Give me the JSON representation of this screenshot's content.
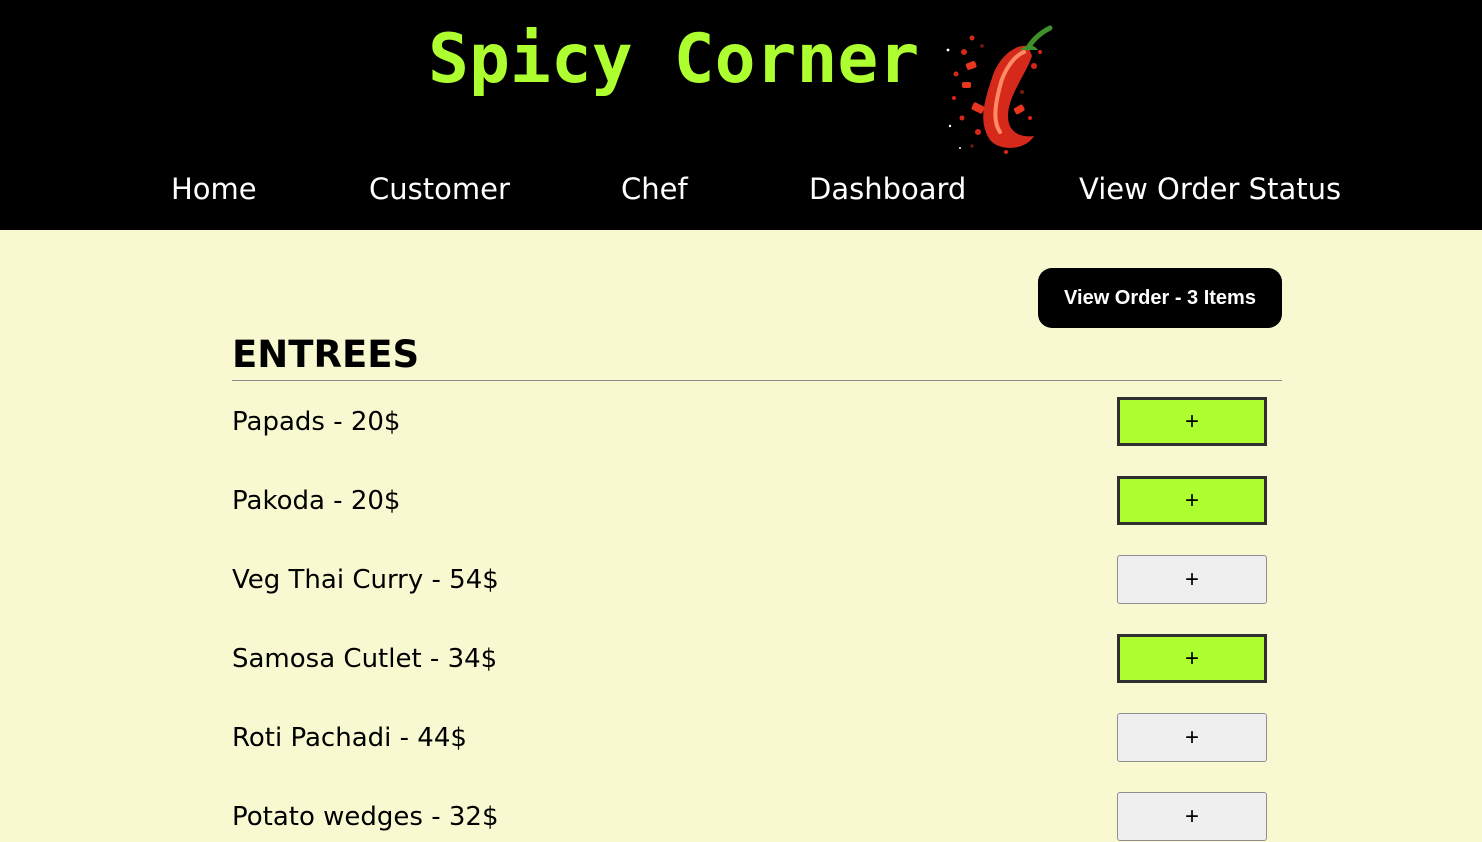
{
  "brand": {
    "title": "Spicy Corner",
    "logo_icon": "chili-pepper-icon"
  },
  "nav": {
    "home": "Home",
    "customer": "Customer",
    "chef": "Chef",
    "dashboard": "Dashboard",
    "order_status": "View Order Status"
  },
  "order": {
    "button_label": "View Order - 3 Items"
  },
  "menu": {
    "section_title": "ENTREES",
    "add_label": "+",
    "items": [
      {
        "label": "Papads - 20$",
        "selected": true
      },
      {
        "label": "Pakoda - 20$",
        "selected": true
      },
      {
        "label": "Veg Thai Curry - 54$",
        "selected": false
      },
      {
        "label": "Samosa Cutlet - 34$",
        "selected": true
      },
      {
        "label": "Roti Pachadi - 44$",
        "selected": false
      },
      {
        "label": "Potato wedges - 32$",
        "selected": false
      }
    ]
  },
  "colors": {
    "brand_green": "#adff2f",
    "header_bg": "#000000",
    "page_bg": "#f8f9d0",
    "button_default": "#efefef"
  }
}
